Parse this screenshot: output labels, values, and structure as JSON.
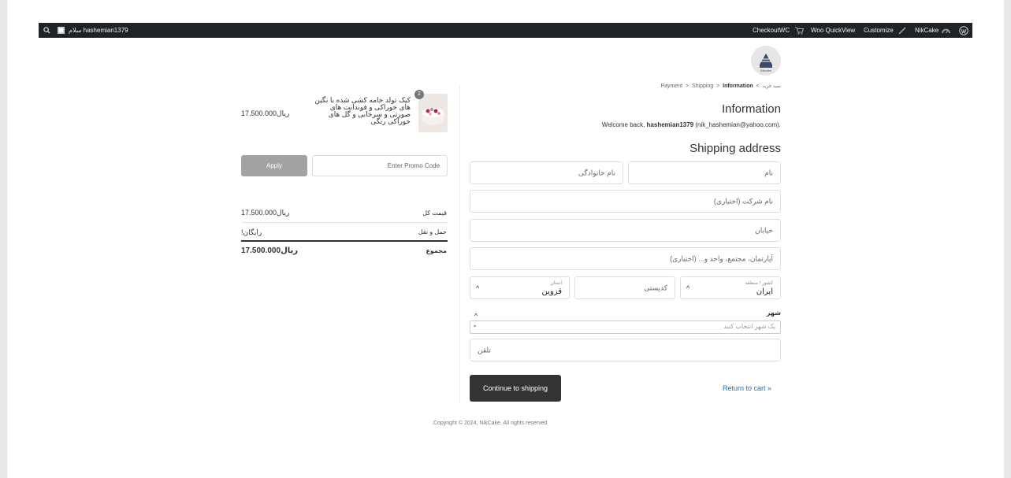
{
  "admin_bar": {
    "greeting": "سلام hashemian1379",
    "items_right": [
      "CheckoutWC",
      "Woo QuickView",
      "Customize",
      "NikCake"
    ]
  },
  "brand": {
    "logo_text": "Nikcake"
  },
  "breadcrumb": {
    "cart": "سبد خرید",
    "information": "Information",
    "shipping": "Shipping",
    "payment": "Payment"
  },
  "checkout": {
    "heading": "Information",
    "welcome_prefix": "Welcome back, ",
    "username": "hashemian1379",
    "email": "(nik_hashemian@yahoo.com).",
    "shipping_heading": "Shipping address",
    "fields": {
      "first_name": "نام",
      "last_name": "نام خانوادگی",
      "company": "نام شرکت (اختیاری)",
      "street": "خیابان",
      "apartment": "آپارتمان، مجتمع، واحد و... (اختیاری)",
      "country_label": "کشور / منطقه",
      "country_value": "ایران",
      "postcode": "کدپستی",
      "state_label": "استان",
      "state_value": "قزوین",
      "city_label": "شهر",
      "city_placeholder": "یک شهر انتخاب کنید",
      "phone": "تلفن"
    },
    "continue_label": "Continue to shipping",
    "return_label": "« Return to cart"
  },
  "cart": {
    "quantity": "2",
    "product_name": "کیک تولد خامه کشی شده با نگین های خوراکی و فوندانت های صورتی و سرخابی و گل های خوراکی رنگی",
    "product_price": "17.500.000ریال",
    "promo_placeholder": "Enter Promo Code",
    "apply_label": "Apply",
    "subtotal_label": "قیمت کل",
    "subtotal_value": "17.500.000ریال",
    "shipping_label": "حمل و نقل",
    "shipping_value": "رایگان!",
    "total_label": "مجموع",
    "total_value": "17.500.000ریال"
  },
  "footer": {
    "copyright": "Copyright © 2024, NikCake. All rights reserved."
  }
}
